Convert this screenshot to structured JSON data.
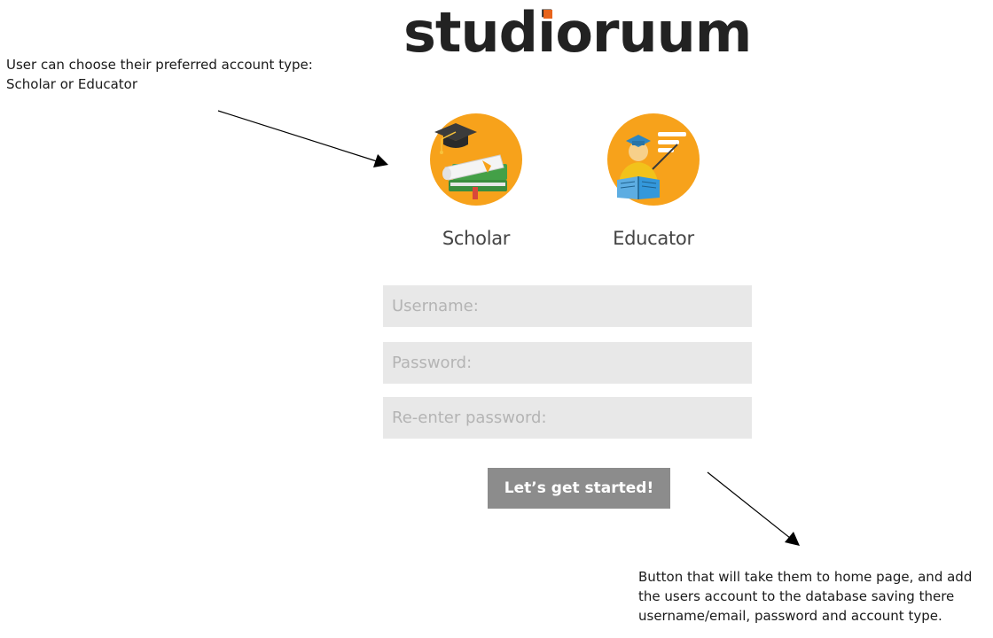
{
  "brand": {
    "name": "studioruum",
    "accent_color": "#e8641c"
  },
  "annotations": {
    "top_line1": "User can choose their preferred account type:",
    "top_line2": "Scholar or Educator",
    "bottom_line1": "Button that will take them to home page, and add",
    "bottom_line2": "the users account to the database saving there",
    "bottom_line3": "username/email, password and account type."
  },
  "account_types": {
    "scholar": {
      "label": "Scholar",
      "icon": "scholar-books-graduation-cap-icon"
    },
    "educator": {
      "label": "Educator",
      "icon": "educator-teacher-reading-icon"
    }
  },
  "form": {
    "username_placeholder": "Username:",
    "password_placeholder": "Password:",
    "reenter_placeholder": "Re-enter password:",
    "submit_label": "Let’s get started!"
  },
  "colors": {
    "icon_circle": "#f7a21b",
    "input_bg": "#e8e8e8",
    "button_bg": "#8c8c8c"
  }
}
